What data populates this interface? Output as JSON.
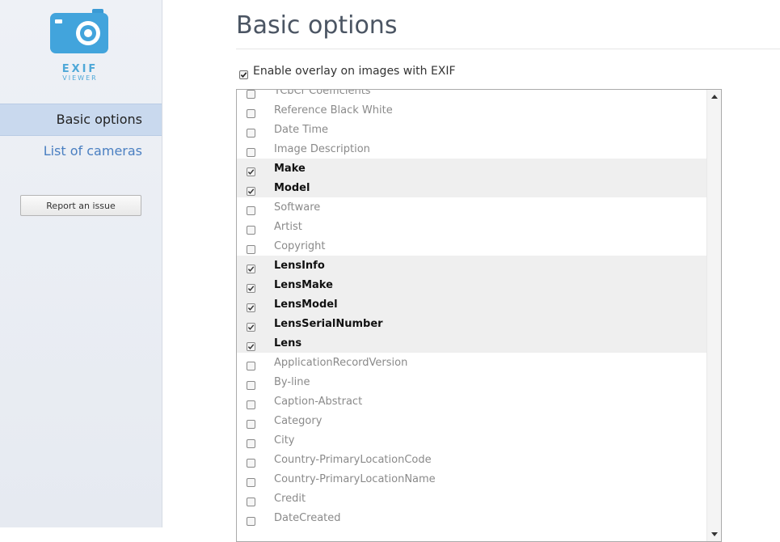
{
  "app": {
    "logo_line1": "EXIF",
    "logo_line2": "VIEWER",
    "accent_color": "#4fa8d8"
  },
  "sidebar": {
    "nav": [
      {
        "label": "Basic options",
        "active": true
      },
      {
        "label": "List of cameras",
        "active": false
      }
    ],
    "report_button": "Report an issue"
  },
  "main": {
    "title": "Basic options",
    "enable_overlay": {
      "label": "Enable overlay on images with EXIF",
      "checked": true
    },
    "fields": [
      {
        "label": "YCbCr Coefficients",
        "checked": false
      },
      {
        "label": "Reference Black White",
        "checked": false
      },
      {
        "label": "Date Time",
        "checked": false
      },
      {
        "label": "Image Description",
        "checked": false
      },
      {
        "label": "Make",
        "checked": true
      },
      {
        "label": "Model",
        "checked": true
      },
      {
        "label": "Software",
        "checked": false
      },
      {
        "label": "Artist",
        "checked": false
      },
      {
        "label": "Copyright",
        "checked": false
      },
      {
        "label": "LensInfo",
        "checked": true
      },
      {
        "label": "LensMake",
        "checked": true
      },
      {
        "label": "LensModel",
        "checked": true
      },
      {
        "label": "LensSerialNumber",
        "checked": true
      },
      {
        "label": "Lens",
        "checked": true
      },
      {
        "label": "ApplicationRecordVersion",
        "checked": false
      },
      {
        "label": "By-line",
        "checked": false
      },
      {
        "label": "Caption-Abstract",
        "checked": false
      },
      {
        "label": "Category",
        "checked": false
      },
      {
        "label": "City",
        "checked": false
      },
      {
        "label": "Country-PrimaryLocationCode",
        "checked": false
      },
      {
        "label": "Country-PrimaryLocationName",
        "checked": false
      },
      {
        "label": "Credit",
        "checked": false
      },
      {
        "label": "DateCreated",
        "checked": false
      }
    ]
  }
}
